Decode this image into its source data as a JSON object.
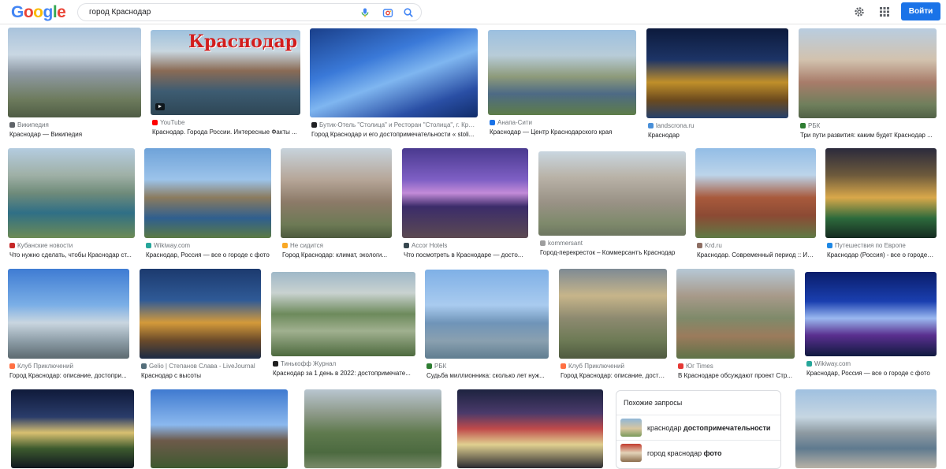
{
  "header": {
    "logo_letters": [
      {
        "ch": "G",
        "color": "#4285f4"
      },
      {
        "ch": "o",
        "color": "#ea4335"
      },
      {
        "ch": "o",
        "color": "#fbbc05"
      },
      {
        "ch": "g",
        "color": "#4285f4"
      },
      {
        "ch": "l",
        "color": "#34a853"
      },
      {
        "ch": "e",
        "color": "#ea4335"
      }
    ],
    "query": "город Краснодар",
    "login_label": "Войти",
    "icons": [
      "mic-icon",
      "camera-icon",
      "search-icon",
      "gear-icon",
      "apps-icon"
    ]
  },
  "images": [
    {
      "source": "Википедия",
      "title": "Краснодар — Википедия",
      "favicon": "#5f6368",
      "palette": "city-day"
    },
    {
      "source": "YouTube",
      "title": "Краснодар. Города России. Интересные Факты ...",
      "favicon": "#ff0000",
      "overlay_text": "Краснодар",
      "video": true,
      "palette": "city-river"
    },
    {
      "source": "Бутик-Отель \"Столица\" и Ресторан \"Столица\", г. Крас...",
      "title": "Город Краснодар и его достопримечательности « stoli...",
      "favicon": "#202124",
      "palette": "night-blue"
    },
    {
      "source": "Анапа-Сити",
      "title": "Краснодар — Центр Краснодарского края",
      "favicon": "#1a73e8",
      "palette": "river-wide"
    },
    {
      "source": "landscrona.ru",
      "title": "Краснодар",
      "favicon": "#4a90d9",
      "palette": "night-gold"
    },
    {
      "source": "РБК",
      "title": "Три пути развития: каким будет Краснодар ...",
      "favicon": "#2e7d32",
      "palette": "city-aerial"
    },
    {
      "source": "Кубанские новости",
      "title": "Что нужно сделать, чтобы Краснодар ст...",
      "favicon": "#c62828",
      "palette": "river-bend"
    },
    {
      "source": "Wikiway.com",
      "title": "Краснодар, Россия — все о городе с фото",
      "favicon": "#26a69a",
      "palette": "tower-water"
    },
    {
      "source": "Не сидится",
      "title": "Город Краснодар: климат, экологи...",
      "favicon": "#f9a825",
      "palette": "old-town"
    },
    {
      "source": "Accor Hotels",
      "title": "Что посмотреть в Краснодаре — досто...",
      "favicon": "#37474f",
      "palette": "purple-dusk"
    },
    {
      "source": "kommersant",
      "title": "Город-перекресток – Коммерсантъ Краснодар",
      "favicon": "#9e9e9e",
      "palette": "dense-city"
    },
    {
      "source": "Krd.ru",
      "title": "Краснодар. Современный период :: Ис...",
      "favicon": "#8d6e63",
      "palette": "arch"
    },
    {
      "source": "Путешествия по Европе",
      "title": "Краснодар (Россия) - все о городе, ...",
      "favicon": "#1e88e5",
      "palette": "stadium-night"
    },
    {
      "source": "Клуб Приключений",
      "title": "Город Краснодар: описание, достопри...",
      "favicon": "#ff7043",
      "palette": "fountain-day"
    },
    {
      "source": "Gelio | Степанов Слава - LiveJournal",
      "title": "Краснодар с высоты",
      "favicon": "#546e7a",
      "palette": "night-streets"
    },
    {
      "source": "Тинькофф Журнал",
      "title": "Краснодар за 1 день в 2022: достопримечате...",
      "favicon": "#212121",
      "palette": "park-stadium"
    },
    {
      "source": "РБК",
      "title": "Судьба миллионника: сколько лет нуж...",
      "favicon": "#2e7d32",
      "palette": "glass-towers"
    },
    {
      "source": "Клуб Приключений",
      "title": "Город Краснодар: описание, достопри...",
      "favicon": "#ff7043",
      "palette": "park-amph"
    },
    {
      "source": "Юг Times",
      "title": "В Краснодаре обсуждают проект Стр...",
      "favicon": "#e53935",
      "palette": "avenue"
    },
    {
      "source": "Wikiway.com",
      "title": "Краснодар, Россия — все о городе с фото",
      "favicon": "#26a69a",
      "palette": "fountain-night"
    },
    {
      "source": "",
      "title": "",
      "favicon": "#000",
      "palette": "stadium-night2"
    },
    {
      "source": "",
      "title": "",
      "favicon": "#000",
      "palette": "statue"
    },
    {
      "source": "",
      "title": "",
      "favicon": "#000",
      "palette": "green-city"
    },
    {
      "source": "",
      "title": "",
      "favicon": "#000",
      "palette": "fountain-lights"
    },
    {
      "source": "",
      "title": "",
      "favicon": "#000",
      "palette": "embankment"
    }
  ],
  "related": {
    "heading": "Похожие запросы",
    "items": [
      {
        "plain": "краснодар ",
        "bold": "достопримечательности"
      },
      {
        "plain": "город краснодар ",
        "bold": "фото"
      }
    ]
  }
}
